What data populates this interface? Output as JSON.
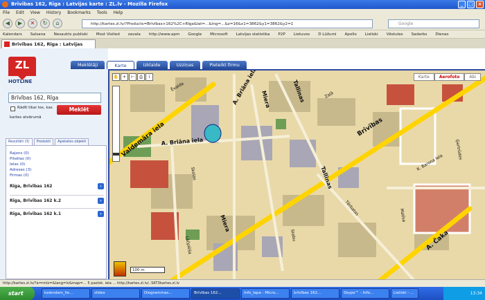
{
  "window": {
    "title": "Brīvības 162, Rīga : Latvijas karte : ZL.lv - Mozilla Firefox"
  },
  "menu": [
    "File",
    "Edit",
    "View",
    "History",
    "Bookmarks",
    "Tools",
    "Help"
  ],
  "nav": {
    "url": "http://kartes.zl.lv/?Products=Brīvības+162%2C+Rīga&lat=...&lng=...&z=16&x1=3862&y1=3862&y2=1",
    "search_placeholder": "Google"
  },
  "bookmarks": [
    "Kalendars",
    "Salsana",
    "Nesaukts publiski",
    "Most Visited",
    "zavala",
    "http://www.apm",
    "Google",
    "Microsoft",
    "Latvijas statistika",
    "P2P",
    "Lietuvos",
    "D Lūžumi",
    "Apollo",
    "Lieliski",
    "Vēstules",
    "Sadarbs",
    "Dienas"
  ],
  "tab": {
    "label": "Brīvības 162, Rīga : Latvijas karte : Z..."
  },
  "sidebar": {
    "logo": "ZL",
    "hotline": "HOTLINE",
    "search_value": "Brīvības 162, Rīga",
    "only_label": "Rādīt tikai tos, kas",
    "search_button": "Meklēt",
    "kartes": "kartes atvērumā",
    "result_tabs": [
      "Rezultāti (3)",
      "Produkti",
      "Apskates objekti"
    ],
    "categories": [
      "Rajons (0)",
      "Pilsētas (0)",
      "Ielas (0)",
      "Adreses (3)",
      "Firmas (0)"
    ],
    "results": [
      "Rīga, Brīvības 162",
      "Rīga, Brīvības 162 k.2",
      "Rīga, Brīvības 162 k.1"
    ]
  },
  "map": {
    "tabs": [
      "Meklētāji",
      "Karte",
      "Izklaide",
      "Uzziņas",
      "Pieteikt firmu"
    ],
    "active_tab": 1,
    "view_tabs": [
      "Karte",
      "Aerofoto",
      "Abi"
    ],
    "active_view": 1,
    "scale": "100 m",
    "streets": [
      "Valdemāra iela",
      "A. Briāna iela",
      "A. Briāna iela",
      "Miera",
      "Miera",
      "Tallinas",
      "Tallinas",
      "Brīvības",
      "A. Čaka",
      "Tērbatas",
      "Stabu",
      "Matīsa",
      "Lāčplēša",
      "Ģertrūdes",
      "K. Barona iela",
      "Ēvalda",
      "Skolas",
      "Zaļā"
    ]
  },
  "status": "http://kartes.zl.lv/?a=rmIz=&lang=lv&map=... 5 pastsk. iela ... http://kartes.zl.lv/..SKT3kartes.zl.lv",
  "taskbar": {
    "start": "start",
    "items": [
      "kalendars_lie...",
      "slides",
      "Diogrammas...",
      "Brīvības 162...",
      "Info_lapa - Micro...",
      "brīvības 162...",
      "Skype™ - Info...",
      "Lieliski - ..."
    ],
    "active_item": 3,
    "time": "13:34"
  },
  "colors": {
    "accent": "#2a4aa0",
    "brand": "#d42525",
    "road_major": "#ffd400"
  }
}
